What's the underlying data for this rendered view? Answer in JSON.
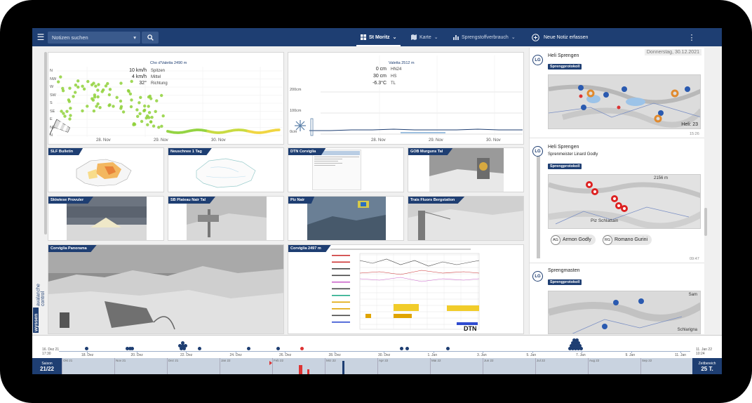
{
  "topbar": {
    "search_placeholder": "Notizen suchen",
    "tabs": [
      {
        "label": "St Moritz",
        "icon": "dashboard-icon",
        "active": true
      },
      {
        "label": "Karte",
        "icon": "map-icon",
        "active": false
      },
      {
        "label": "Sprengstoffverbrauch",
        "icon": "bar-chart-icon",
        "active": false
      }
    ],
    "new_note": "Neue Notiz erfassen"
  },
  "weather_left": {
    "station": "Cho d'Valetta 2490 m",
    "readings": [
      {
        "value": "10 km/h",
        "label": "Spitzen"
      },
      {
        "value": "4 km/h",
        "label": "Mittel"
      },
      {
        "value": "32°",
        "label": "Richtung"
      }
    ],
    "directions": [
      "N",
      "NW",
      "W",
      "SW",
      "S",
      "SE",
      "E",
      "NE",
      "N"
    ],
    "dates": [
      "28. Nov",
      "29. Nov",
      "30. Nov"
    ]
  },
  "weather_right": {
    "station": "Valetta 2512 m",
    "readings": [
      {
        "value": "0 cm",
        "label": "HN24"
      },
      {
        "value": "30 cm",
        "label": "HS"
      },
      {
        "value": "-6.3°C",
        "label": "TL"
      }
    ],
    "levels": [
      "200cm",
      "100cm",
      "0cm"
    ],
    "dates": [
      "28. Nov",
      "29. Nov",
      "30. Nov"
    ]
  },
  "tiles": [
    "SLF Bulletin",
    "Neuschnee 1 Tag",
    "DTN Corviglia",
    "GOB Murguns Tal",
    "Skiwiese Provuler",
    "SB Plateau Nair Tal",
    "Piz Nair",
    "Trais Fluors Bergstation",
    "Corviglia Panorama",
    "Corviglia 2497 m"
  ],
  "dtn_logo": "DTN",
  "brand": {
    "name": "wyssen",
    "line1": "avalanche",
    "line2": "control"
  },
  "notes": {
    "date": "Donnerstag, 30.12.2021",
    "items": [
      {
        "avatar": "LG",
        "title": "Heli Sprengen",
        "tag": "Sprengprotokoll",
        "map_label": "Heli: 23",
        "time": "15:26"
      },
      {
        "avatar": "LG",
        "title": "Heli Sprengen",
        "subtitle": "Sprenmeister Linard Godly",
        "tag": "Sprengprotokoll",
        "map_label1": "2156 m",
        "map_label2": "Piz Schlattain",
        "time": "09:47",
        "people": [
          {
            "initials": "AG",
            "name": "Armon Godly"
          },
          {
            "initials": "RG",
            "name": "Romano Gurini"
          }
        ]
      },
      {
        "avatar": "LG",
        "title": "Sprengmasten",
        "tag": "Sprengprotokoll",
        "map_label1": "Sam",
        "map_label2": "Schlarigna"
      }
    ]
  },
  "timeline": {
    "left_edge": [
      "16. Dez 21",
      "17:30"
    ],
    "right_edge": [
      "11. Jan 22",
      "10:24"
    ],
    "ticks": [
      "18. Dez",
      "20. Dez",
      "22. Dez",
      "24. Dez",
      "26. Dez",
      "28. Dez",
      "30. Dez",
      "1. Jan",
      "3. Jan",
      "5. Jan",
      "7. Jan",
      "9. Jan",
      "11. Jan"
    ],
    "season_label": "Saison",
    "season_value": "21/22",
    "range_label": "Zeitbereich",
    "range_value": "25 T.",
    "sub_ticks": [
      "Okt 21",
      "Nov 21",
      "Dez 21",
      "Jan 22",
      "Feb 22",
      "Mrz 22",
      "Apr 22",
      "Mai 22",
      "Jun 22",
      "Jul 22",
      "Aug 22",
      "Sep 22"
    ]
  },
  "colors": {
    "brand": "#1e3e72",
    "accent_red": "#d33333",
    "marker_orange": "#e08a2e",
    "wind_green": "#8fd13a"
  }
}
